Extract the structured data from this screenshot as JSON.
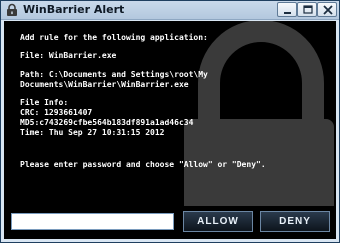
{
  "window": {
    "title": "WinBarrier Alert"
  },
  "message": {
    "heading": "Add rule for the following application:",
    "file_line": "File: WinBarrier.exe",
    "path_line1": "Path: C:\\Documents and Settings\\root\\My",
    "path_line2": "Documents\\WinBarrier\\WinBarrier.exe",
    "info_title": "File Info:",
    "crc": "CRC: 1293661407",
    "md5": "MD5:c743269cfbe564b183df891a1ad46c34",
    "time": "Time: Thu Sep 27 10:31:15 2012",
    "prompt": "Please enter password and choose \"Allow\" or \"Deny\"."
  },
  "controls": {
    "password_value": "",
    "allow_label": "Allow",
    "deny_label": "Deny"
  },
  "icons": {
    "title": "lock-icon",
    "background": "padlock-icon"
  },
  "colors": {
    "content_bg": "#000000",
    "text": "#ffffff",
    "lock": "#3a3a3a",
    "titlebar": "#c1d3e6"
  }
}
